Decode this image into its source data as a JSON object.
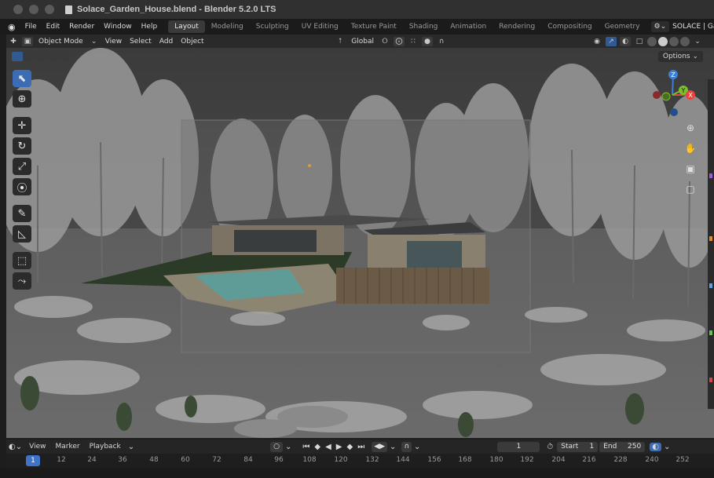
{
  "window": {
    "title": "Solace_Garden_House.blend - Blender 5.2.0 LTS"
  },
  "menubar": {
    "menus": [
      "File",
      "Edit",
      "Render",
      "Window",
      "Help"
    ],
    "workspaces": [
      "Layout",
      "Modeling",
      "Sculpting",
      "UV Editing",
      "Texture Paint",
      "Shading",
      "Animation",
      "Rendering",
      "Compositing",
      "Geometry"
    ],
    "active_workspace": "Layout",
    "scene_name": "SOLACE | Garden House — Architectural Stu"
  },
  "viewport_header": {
    "mode": "Object Mode",
    "menus": [
      "View",
      "Select",
      "Add",
      "Object"
    ],
    "orientation": "Global",
    "options_label": "Options"
  },
  "navigation_gizmo": {
    "axes": [
      "Z",
      "Y",
      "X"
    ],
    "colors": {
      "x": "#e8433f",
      "y": "#7bbf2b",
      "z": "#3c7fd8"
    }
  },
  "timeline": {
    "menus": [
      "View",
      "Marker",
      "Playback"
    ],
    "current_frame": "1",
    "start_label": "Start",
    "start_value": "1",
    "end_label": "End",
    "end_value": "250",
    "ruler_current": "1",
    "ruler_ticks": [
      "12",
      "24",
      "36",
      "48",
      "60",
      "72",
      "84",
      "96",
      "108",
      "120",
      "132",
      "144",
      "156",
      "168",
      "180",
      "192",
      "204",
      "216",
      "228",
      "240",
      "252"
    ]
  },
  "colors": {
    "accent": "#3b6cb5",
    "pool_water": "#5f9b97",
    "lawn": "#2b3b27"
  }
}
